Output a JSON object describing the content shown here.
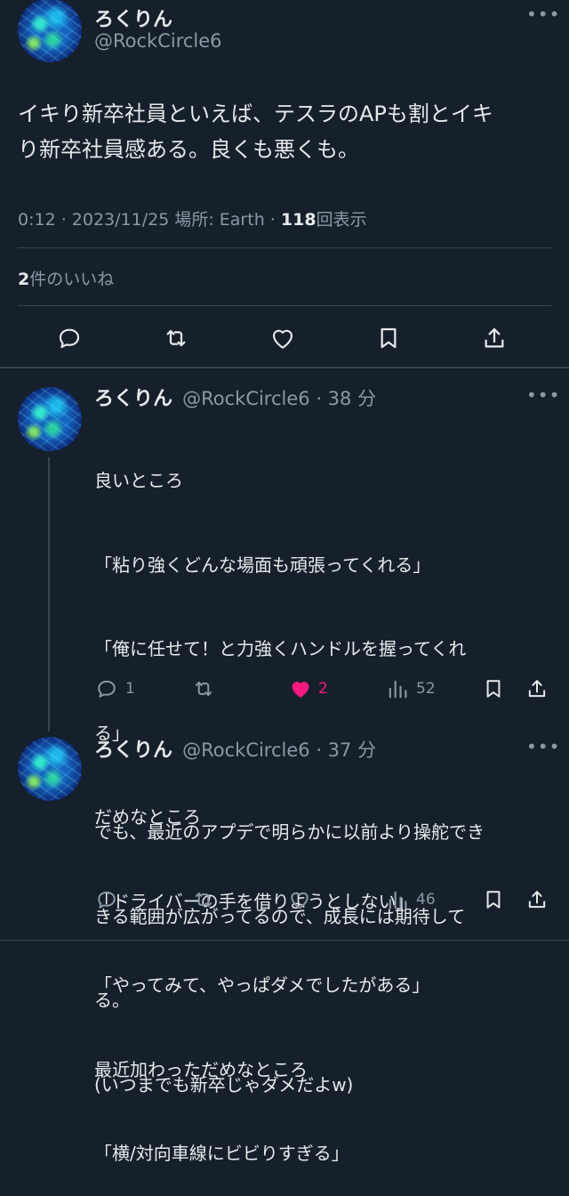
{
  "tweet": {
    "name": "ろくりん",
    "handle": "@RockCircle6",
    "more": "•••",
    "text_line1": "イキり新卒社員といえば、テスラのAPも割とイキ",
    "text_line2": "り新卒社員感ある。良くも悪くも。",
    "time": "0:12 · 2023/11/25",
    "location": "場所: Earth",
    "views_count": "118",
    "views_label": "回表示",
    "likes_count": "2",
    "likes_label": "件のいいね"
  },
  "replies": [
    {
      "name": "ろくりん",
      "handle": "@RockCircle6 · 38 分",
      "more": "•••",
      "lines": [
        "良いところ",
        "「粘り強くどんな場面も頑張ってくれる」",
        "「俺に任せて！と力強くハンドルを握ってくれ",
        "る」",
        "だめなところ",
        "「ドライバーの手を借りようとしない」",
        "「やってみて、やっぱダメでしたがある」",
        "最近加わっただめなところ",
        "「横/対向車線にビビりすぎる」"
      ],
      "reply_count": "1",
      "like_count": "2",
      "view_count": "52"
    },
    {
      "name": "ろくりん",
      "handle": "@RockCircle6 · 37 分",
      "more": "•••",
      "lines": [
        "でも、最近のアプデで明らかに以前より操舵でき",
        "きる範囲が広がってるので、成長には期待して",
        "る。",
        "(いつまでも新卒じゃダメだよw)"
      ],
      "view_count": "46"
    }
  ],
  "colors": {
    "background": "#15202b",
    "text": "#e7e9ea",
    "secondary": "#8b98a5",
    "divider": "#38444d",
    "like": "#f91880"
  }
}
